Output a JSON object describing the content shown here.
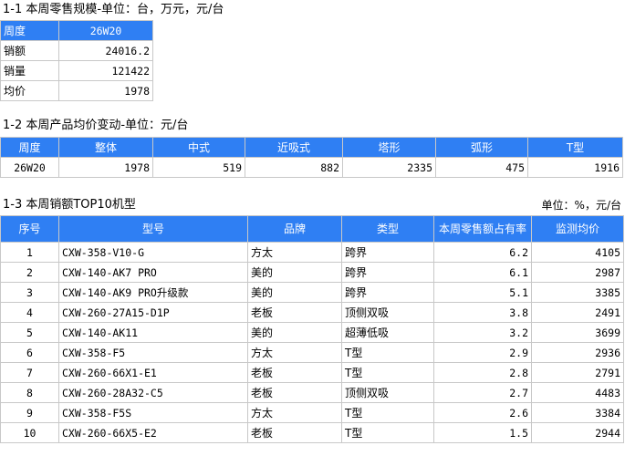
{
  "section1": {
    "title": "1-1 本周零售规模-单位：台，万元，元/台",
    "header_label": "周度",
    "header_value": "26W20",
    "rows": [
      {
        "label": "销额",
        "value": "24016.2"
      },
      {
        "label": "销量",
        "value": "121422"
      },
      {
        "label": "均价",
        "value": "1978"
      }
    ]
  },
  "section2": {
    "title": "1-2 本周产品均价变动-单位：元/台",
    "headers": [
      "周度",
      "整体",
      "中式",
      "近吸式",
      "塔形",
      "弧形",
      "T型"
    ],
    "row": [
      "26W20",
      "1978",
      "519",
      "882",
      "2335",
      "475",
      "1916"
    ]
  },
  "section3": {
    "title": "1-3 本周销额TOP10机型",
    "unit": "单位：%，元/台",
    "headers": [
      "序号",
      "型号",
      "品牌",
      "类型",
      "本周零售额占有率",
      "监测均价"
    ],
    "rows": [
      [
        "1",
        "CXW-358-V10-G",
        "方太",
        "跨界",
        "6.2",
        "4105"
      ],
      [
        "2",
        "CXW-140-AK7 PRO",
        "美的",
        "跨界",
        "6.1",
        "2987"
      ],
      [
        "3",
        "CXW-140-AK9 PRO升级款",
        "美的",
        "跨界",
        "5.1",
        "3385"
      ],
      [
        "4",
        "CXW-260-27A15-D1P",
        "老板",
        "顶侧双吸",
        "3.8",
        "2491"
      ],
      [
        "5",
        "CXW-140-AK11",
        "美的",
        "超薄低吸",
        "3.2",
        "3699"
      ],
      [
        "6",
        "CXW-358-F5",
        "方太",
        "T型",
        "2.9",
        "2936"
      ],
      [
        "7",
        "CXW-260-66X1-E1",
        "老板",
        "T型",
        "2.8",
        "2791"
      ],
      [
        "8",
        "CXW-260-28A32-C5",
        "老板",
        "顶侧双吸",
        "2.7",
        "4483"
      ],
      [
        "9",
        "CXW-358-F5S",
        "方太",
        "T型",
        "2.6",
        "3384"
      ],
      [
        "10",
        "CXW-260-66X5-E2",
        "老板",
        "T型",
        "1.5",
        "2944"
      ]
    ]
  }
}
